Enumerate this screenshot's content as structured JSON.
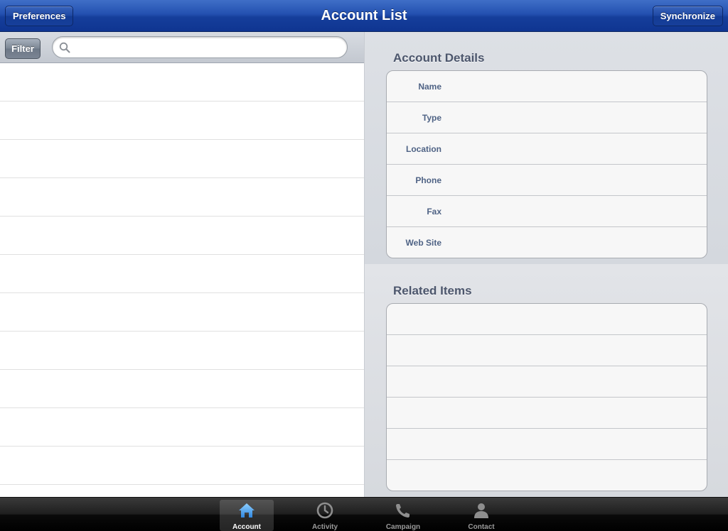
{
  "navbar": {
    "title": "Account List",
    "left_button": "Preferences",
    "right_button": "Synchronize"
  },
  "search": {
    "filter_label": "Filter",
    "value": "",
    "icon": "search-icon"
  },
  "account_list": {
    "rows": [
      "",
      "",
      "",
      "",
      "",
      "",
      "",
      "",
      "",
      "",
      "",
      ""
    ]
  },
  "account_details": {
    "title": "Account Details",
    "fields": [
      {
        "label": "Name",
        "value": ""
      },
      {
        "label": "Type",
        "value": ""
      },
      {
        "label": "Location",
        "value": ""
      },
      {
        "label": "Phone",
        "value": ""
      },
      {
        "label": "Fax",
        "value": ""
      },
      {
        "label": "Web Site",
        "value": ""
      }
    ]
  },
  "related_items": {
    "title": "Related Items",
    "rows": [
      "",
      "",
      "",
      "",
      "",
      ""
    ]
  },
  "tabbar": {
    "selected": "Account",
    "tabs": [
      {
        "label": "Account",
        "icon": "home-icon"
      },
      {
        "label": "Activity",
        "icon": "clock-icon"
      },
      {
        "label": "Campaign",
        "icon": "phone-icon"
      },
      {
        "label": "Contact",
        "icon": "person-icon"
      }
    ],
    "selected_color": "#5aa9f0"
  }
}
